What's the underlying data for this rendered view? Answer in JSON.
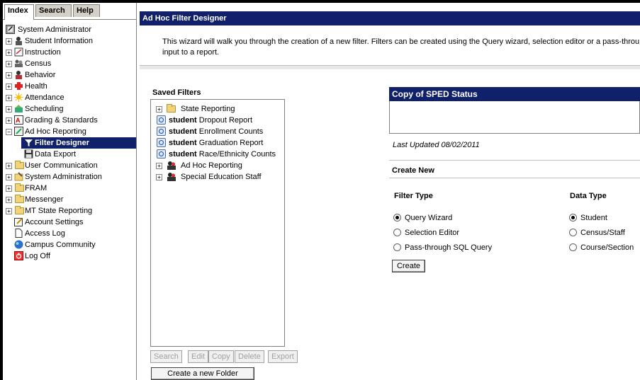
{
  "nav": {
    "tabs": [
      {
        "label": "Index"
      },
      {
        "label": "Search"
      },
      {
        "label": "Help"
      }
    ],
    "root": "System Administrator",
    "items": [
      {
        "label": "Student Information"
      },
      {
        "label": "Instruction"
      },
      {
        "label": "Census"
      },
      {
        "label": "Behavior"
      },
      {
        "label": "Health"
      },
      {
        "label": "Attendance"
      },
      {
        "label": "Scheduling"
      },
      {
        "label": "Grading & Standards"
      },
      {
        "label": "Ad Hoc Reporting"
      },
      {
        "label": "Filter Designer"
      },
      {
        "label": "Data Export"
      },
      {
        "label": "User Communication"
      },
      {
        "label": "System Administration"
      },
      {
        "label": "FRAM"
      },
      {
        "label": "Messenger"
      },
      {
        "label": "MT State Reporting"
      },
      {
        "label": "Account Settings"
      },
      {
        "label": "Access Log"
      },
      {
        "label": "Campus Community"
      },
      {
        "label": "Log Off"
      }
    ]
  },
  "main": {
    "title": "Ad Hoc Filter Designer",
    "description_line1": "This wizard will walk you through the creation of a new filter. Filters can be created using the Query wizard, selection editor or a pass-throu",
    "description_line2": "input to a report.",
    "saved_filters": {
      "title": "Saved Filters",
      "items": [
        {
          "prefix": "",
          "label": "State Reporting"
        },
        {
          "prefix": "student",
          "label": " Dropout Report"
        },
        {
          "prefix": "student",
          "label": " Enrollment Counts"
        },
        {
          "prefix": "student",
          "label": " Graduation Report"
        },
        {
          "prefix": "student",
          "label": " Race/Ethnicity Counts"
        },
        {
          "prefix": "",
          "label": "Ad Hoc Reporting"
        },
        {
          "prefix": "",
          "label": "Special Education Staff"
        }
      ],
      "buttons": {
        "search": "Search",
        "edit": "Edit",
        "copy": "Copy",
        "delete": "Delete",
        "export": "Export",
        "new_folder": "Create a new Folder"
      }
    },
    "detail": {
      "filter_name": "Copy of SPED Status",
      "last_updated": "Last Updated 08/02/2011",
      "create_new": "Create New",
      "filter_type_header": "Filter Type",
      "data_type_header": "Data Type",
      "filter_types": [
        {
          "label": "Query Wizard",
          "checked": true
        },
        {
          "label": "Selection Editor",
          "checked": false
        },
        {
          "label": "Pass-through SQL Query",
          "checked": false
        }
      ],
      "data_types": [
        {
          "label": "Student",
          "checked": true
        },
        {
          "label": "Census/Staff",
          "checked": false
        },
        {
          "label": "Course/Section",
          "checked": false
        }
      ],
      "create_button": "Create"
    }
  },
  "colors": {
    "header_bg": "#10206a",
    "selected_bg": "#10206a",
    "folder": "#f2d27a"
  }
}
